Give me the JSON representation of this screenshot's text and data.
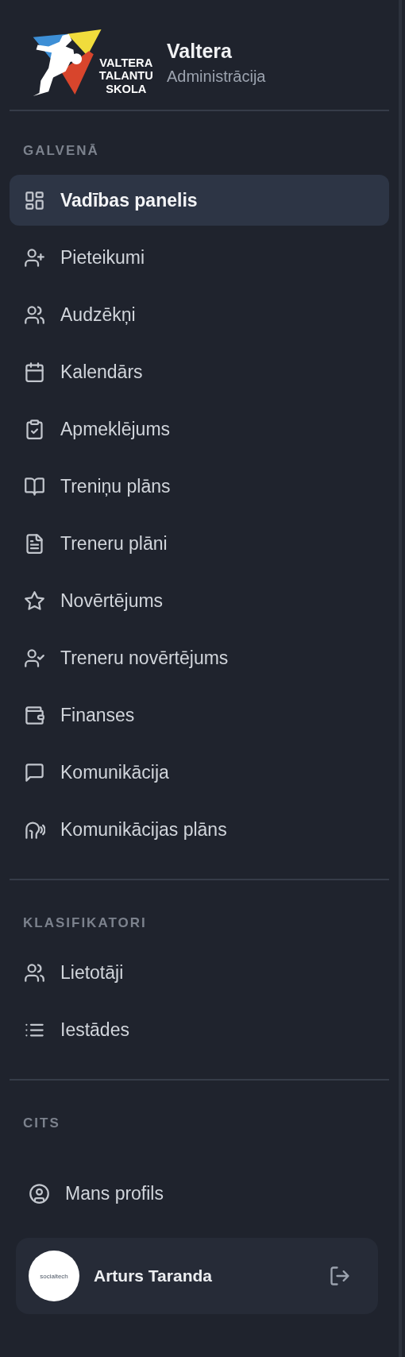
{
  "brand": {
    "logo_lines": [
      "VALTERA",
      "TALANTU",
      "SKOLA"
    ],
    "title": "Valtera",
    "subtitle": "Administrācija"
  },
  "sections": [
    {
      "heading": "GALVENĀ",
      "items": [
        {
          "label": "Vadības panelis",
          "selected": true
        },
        {
          "label": "Pieteikumi",
          "selected": false
        },
        {
          "label": "Audzēkņi",
          "selected": false
        },
        {
          "label": "Kalendārs",
          "selected": false
        },
        {
          "label": "Apmeklējums",
          "selected": false
        },
        {
          "label": "Treniņu plāns",
          "selected": false
        },
        {
          "label": "Treneru plāni",
          "selected": false
        },
        {
          "label": "Novērtējums",
          "selected": false
        },
        {
          "label": "Treneru novērtējums",
          "selected": false
        },
        {
          "label": "Finanses",
          "selected": false
        },
        {
          "label": "Komunikācija",
          "selected": false
        },
        {
          "label": "Komunikācijas plāns",
          "selected": false
        }
      ]
    },
    {
      "heading": "KLASIFIKATORI",
      "items": [
        {
          "label": "Lietotāji",
          "selected": false
        },
        {
          "label": "Iestādes",
          "selected": false
        }
      ]
    },
    {
      "heading": "CITS",
      "items": [
        {
          "label": "Mans profils",
          "selected": false
        }
      ]
    }
  ],
  "user": {
    "avatar_text": "socialtech",
    "name": "Arturs Taranda"
  }
}
